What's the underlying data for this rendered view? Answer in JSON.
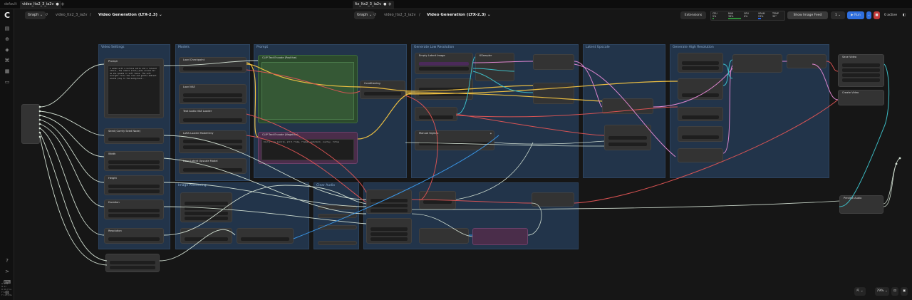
{
  "window_tabs": [
    {
      "label": "default",
      "active": false,
      "dirty": false
    },
    {
      "label": "video_ltx2_3_ia2v",
      "active": true,
      "dirty": true
    },
    {
      "label": "ltx_ltx2_3_ia2v",
      "active": true,
      "dirty": true
    }
  ],
  "workflow_left": {
    "graph": "Graph",
    "file": "video_ltx2_3_ia2v",
    "title": "Video Generation (LTX-2.3)"
  },
  "workflow_right": {
    "graph": "Graph",
    "file": "video_ltx2_3_ia2v",
    "title": "Video Generation (LTX-2.3)"
  },
  "toolbar": {
    "extensions": "Extensions",
    "show_image_feed": "Show Image Feed",
    "queue_count": "1",
    "run": "Run",
    "active": "0 active"
  },
  "stats": [
    {
      "label": "CPU",
      "value": "5%"
    },
    {
      "label": "RAM",
      "value": "38%"
    },
    {
      "label": "GPU",
      "value": "0%"
    },
    {
      "label": "VRAM",
      "value": "23%"
    },
    {
      "label": "TEMP",
      "value": "39°"
    }
  ],
  "sidebar_footer": [
    "Tr 459",
    "N 37",
    "R 46.7ms",
    "F 60",
    "F 1253/6s"
  ],
  "zoom": "79%",
  "groups": [
    "Video Settings",
    "Models",
    "Prompt",
    "Generate Low Resolution",
    "Latent Upscale",
    "Generate High Resolution",
    "Image Processing",
    "Clear Audio"
  ],
  "nodes": [
    "Prompt",
    "Seed (Comfy Seed Node)",
    "Width",
    "Height",
    "Duration",
    "Resolution",
    "Load Checkpoint",
    "Load VAE",
    "Text Audio VAE Loader",
    "LoRA Loader ModelOnly",
    "Load Latent Upscale Model",
    "CLIP Text Encode (Positive)",
    "CLIP Text Encode (Negative)",
    "Conditioning",
    "Empty Latent Image",
    "KSampler",
    "Manual Sigmas",
    "Save Video",
    "Create Video",
    "Preview Audio"
  ],
  "prompt_text": "A woman with a nervous smile and a relaxed stance, the camera slowly pans around her as she speaks in soft tones. The soft sunlight fills the room and gentle ambient sounds play in the background...",
  "neg_text": "blurry, low quality, still frame, frames, watermark, overlay, titles",
  "colors": {
    "accent": "#3b82f6",
    "group": "#22344a",
    "wire_yellow": "#f5c542",
    "wire_red": "#e05555",
    "wire_cyan": "#3fc7d0",
    "wire_pink": "#e78ad7",
    "wire_white": "#d8e6d8"
  }
}
